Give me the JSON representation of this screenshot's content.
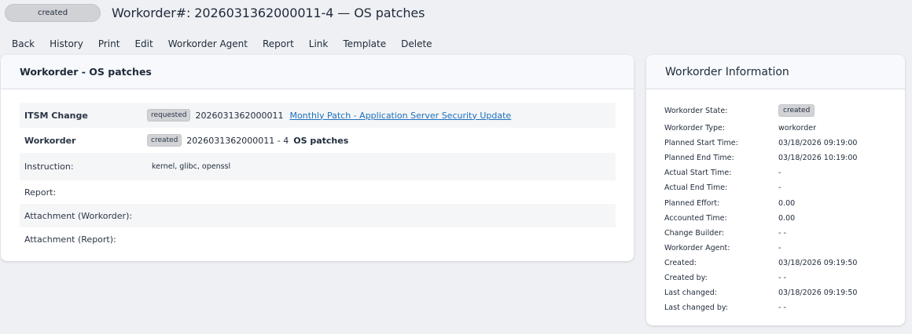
{
  "header": {
    "state": "created",
    "title": "Workorder#: 2026031362000011-4 — OS patches"
  },
  "actions": [
    "Back",
    "History",
    "Print",
    "Edit",
    "Workorder Agent",
    "Report",
    "Link",
    "Template",
    "Delete"
  ],
  "main": {
    "title": "Workorder - OS patches",
    "itsm_change": {
      "label": "ITSM Change",
      "badge": "requested",
      "number": "2026031362000011",
      "link": "Monthly Patch - Application Server Security Update"
    },
    "workorder": {
      "label": "Workorder",
      "badge": "created",
      "number": "2026031362000011 - 4",
      "name": "OS patches"
    },
    "instruction": {
      "label": "Instruction:",
      "value": "kernel, glibc, openssl"
    },
    "report": {
      "label": "Report:"
    },
    "attachment_workorder": {
      "label": "Attachment (Workorder):"
    },
    "attachment_report": {
      "label": "Attachment (Report):"
    }
  },
  "info": {
    "title": "Workorder Information",
    "rows": [
      {
        "label": "Workorder State:",
        "value": "created"
      },
      {
        "label": "Workorder Type:",
        "value": "workorder"
      },
      {
        "label": "Planned Start Time:",
        "value": "03/18/2026 09:19:00"
      },
      {
        "label": "Planned End Time:",
        "value": "03/18/2026 10:19:00"
      },
      {
        "label": "Actual Start Time:",
        "value": "-"
      },
      {
        "label": "Actual End Time:",
        "value": "-"
      },
      {
        "label": "Planned Effort:",
        "value": "0.00"
      },
      {
        "label": "Accounted Time:",
        "value": "0.00"
      },
      {
        "label": "Change Builder:",
        "value": "- -"
      },
      {
        "label": "Workorder Agent:",
        "value": "-"
      },
      {
        "label": "Created:",
        "value": "03/18/2026 09:19:50"
      },
      {
        "label": "Created by:",
        "value": "- -"
      },
      {
        "label": "Last changed:",
        "value": "03/18/2026 09:19:50"
      },
      {
        "label": "Last changed by:",
        "value": "- -"
      }
    ]
  },
  "colors": {
    "link": "#1c6fbd",
    "badge_bg": "#d1d3d6",
    "page_bg": "#eef0f3"
  }
}
